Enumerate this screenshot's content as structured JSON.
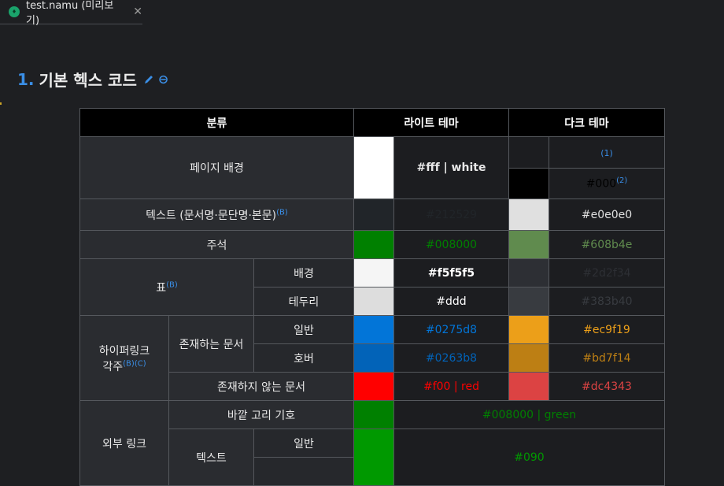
{
  "tab": {
    "title": "test.namu (미리보기)",
    "icon": "namu-file-icon"
  },
  "heading": {
    "number": "1.",
    "title": "기본 헥스 코드"
  },
  "table": {
    "headers": {
      "category": "분류",
      "light": "라이트 테마",
      "dark": "다크 테마"
    },
    "page_bg": {
      "label": "페이지 배경",
      "light_code": "#fff | white",
      "dark_note1": "(1)",
      "dark_code2": "#000",
      "dark_note2": "(2)",
      "light_swatch": "#ffffff",
      "dark_swatch1": "#1c1d20",
      "dark_swatch2": "#000000"
    },
    "text": {
      "label": "텍스트 (문서명·문단명·본문)",
      "sup": "(B)",
      "light_code": "#212529",
      "dark_code": "#e0e0e0",
      "light_swatch": "#212529",
      "dark_swatch": "#e0e0e0",
      "light_color": "#212529",
      "dark_color": "#e0e0e0"
    },
    "comment": {
      "label": "주석",
      "light_code": "#008000",
      "dark_code": "#608b4e",
      "light_swatch": "#008000",
      "dark_swatch": "#608b4e"
    },
    "table_group": {
      "label": "표",
      "sup": "(B)",
      "bg": {
        "label": "배경",
        "light_code": "#f5f5f5",
        "dark_code": "#2d2f34",
        "light_swatch": "#f5f5f5",
        "dark_swatch": "#2d2f34"
      },
      "border": {
        "label": "테두리",
        "light_code": "#ddd",
        "dark_code": "#383b40",
        "light_swatch": "#dddddd",
        "dark_swatch": "#383b40"
      }
    },
    "hyperlink": {
      "label_line1": "하이퍼링크",
      "label_line2": "각주",
      "sup": "(B)(C)",
      "existing": {
        "label": "존재하는 문서",
        "normal": {
          "label": "일반",
          "light_code": "#0275d8",
          "dark_code": "#ec9f19",
          "light_swatch": "#0275d8",
          "dark_swatch": "#ec9f19"
        },
        "hover": {
          "label": "호버",
          "light_code": "#0263b8",
          "dark_code": "#bd7f14",
          "light_swatch": "#0263b8",
          "dark_swatch": "#bd7f14"
        }
      },
      "missing": {
        "label": "존재하지 않는 문서",
        "light_code": "#f00 | red",
        "dark_code": "#dc4343",
        "light_swatch": "#ff0000",
        "dark_swatch": "#dc4343"
      }
    },
    "external": {
      "label": "외부 링크",
      "ring": {
        "label": "바깥 고리 기호",
        "code": "#008000 | green",
        "swatch": "#008000"
      },
      "text": {
        "label": "텍스트",
        "normal_label": "일반",
        "code": "#090",
        "swatch": "#009900"
      }
    }
  }
}
